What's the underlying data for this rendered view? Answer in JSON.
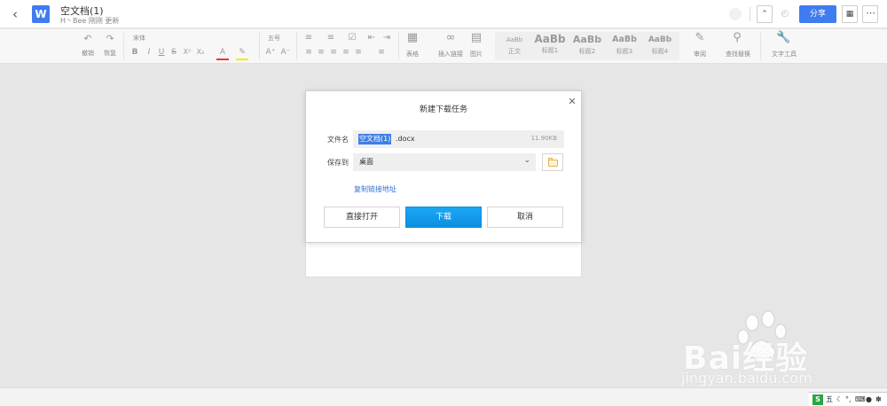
{
  "titlebar": {
    "doc_title": "空文档(1)",
    "doc_subtitle": "H丶Bee 刚刚 更新",
    "app_logo": "W",
    "share_label": "分享",
    "accent": "#3f7cf0"
  },
  "toolbar": {
    "undo": "撤销",
    "redo": "恢复",
    "font_name": "宋体",
    "font_size": "五号",
    "table": "表格",
    "insert_link": "插入链接",
    "image": "图片",
    "styles": [
      {
        "sample": "AaBb",
        "name": "正文"
      },
      {
        "sample": "AaBb",
        "name": "标题1"
      },
      {
        "sample": "AaBb",
        "name": "标题2"
      },
      {
        "sample": "AaBb",
        "name": "标题3"
      },
      {
        "sample": "AaBb",
        "name": "标题4"
      }
    ],
    "review": "审阅",
    "find_replace": "查找替换",
    "text_tools": "文字工具"
  },
  "dialog": {
    "title": "新建下载任务",
    "filename_label": "文件名",
    "filename_selected": "空文档(1)",
    "filename_ext": ".docx",
    "filesize": "11.90KB",
    "saveto_label": "保存到",
    "saveto_value": "桌面",
    "copy_link": "复制链接地址",
    "btn_open": "直接打开",
    "btn_download": "下载",
    "btn_cancel": "取消",
    "download_color": "#16a0f0"
  },
  "tray": {
    "ime": "五"
  },
  "watermark": {
    "text": "Bai经验",
    "url": "jingyan.baidu.com"
  }
}
